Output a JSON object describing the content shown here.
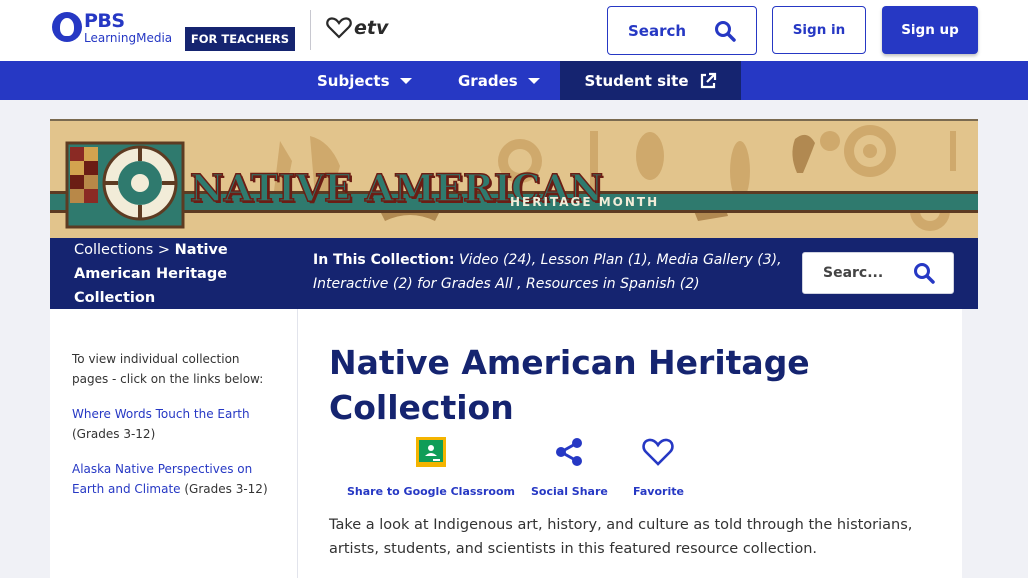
{
  "header": {
    "logo_brand": "PBS",
    "logo_sub": "LearningMedia",
    "audience_badge": "FOR TEACHERS",
    "partner_logo": "etv",
    "search_label": "Search",
    "signin_label": "Sign in",
    "signup_label": "Sign up"
  },
  "nav": {
    "items": [
      {
        "label": "Subjects"
      },
      {
        "label": "Grades"
      },
      {
        "label": "Student site"
      }
    ]
  },
  "banner": {
    "title": "NATIVE AMERICAN",
    "subtitle": "HERITAGE MONTH"
  },
  "collection_bar": {
    "crumb_parent": "Collections",
    "crumb_sep": " > ",
    "crumb_current": "Native American Heritage Collection",
    "in_collection_label": "In This Collection:",
    "in_collection_items": " Video (24), Lesson Plan (1), Media Gallery (3), Interactive (2) for Grades All , Resources in Spanish (2)",
    "search_placeholder": "Searc..."
  },
  "sidebar": {
    "intro": "To view individual collection pages - click on the links below:",
    "links": [
      {
        "label": "Where Words Touch the Earth",
        "grades": "(Grades 3-12)"
      },
      {
        "label": "Alaska Native Perspectives on Earth and Climate",
        "grades": " (Grades 3-12)"
      }
    ]
  },
  "main": {
    "title": "Native American Heritage Collection",
    "actions": [
      {
        "label": "Share to Google Classroom",
        "icon": "google-classroom-icon"
      },
      {
        "label": "Social Share",
        "icon": "share-icon"
      },
      {
        "label": "Favorite",
        "icon": "heart-icon"
      }
    ],
    "description": "Take a look at Indigenous art, history, and culture as told through the historians, artists, students, and scientists in this featured resource collection."
  },
  "colors": {
    "brand_blue": "#2638c4",
    "dark_navy": "#152470",
    "page_bg": "#f0f1f6"
  }
}
